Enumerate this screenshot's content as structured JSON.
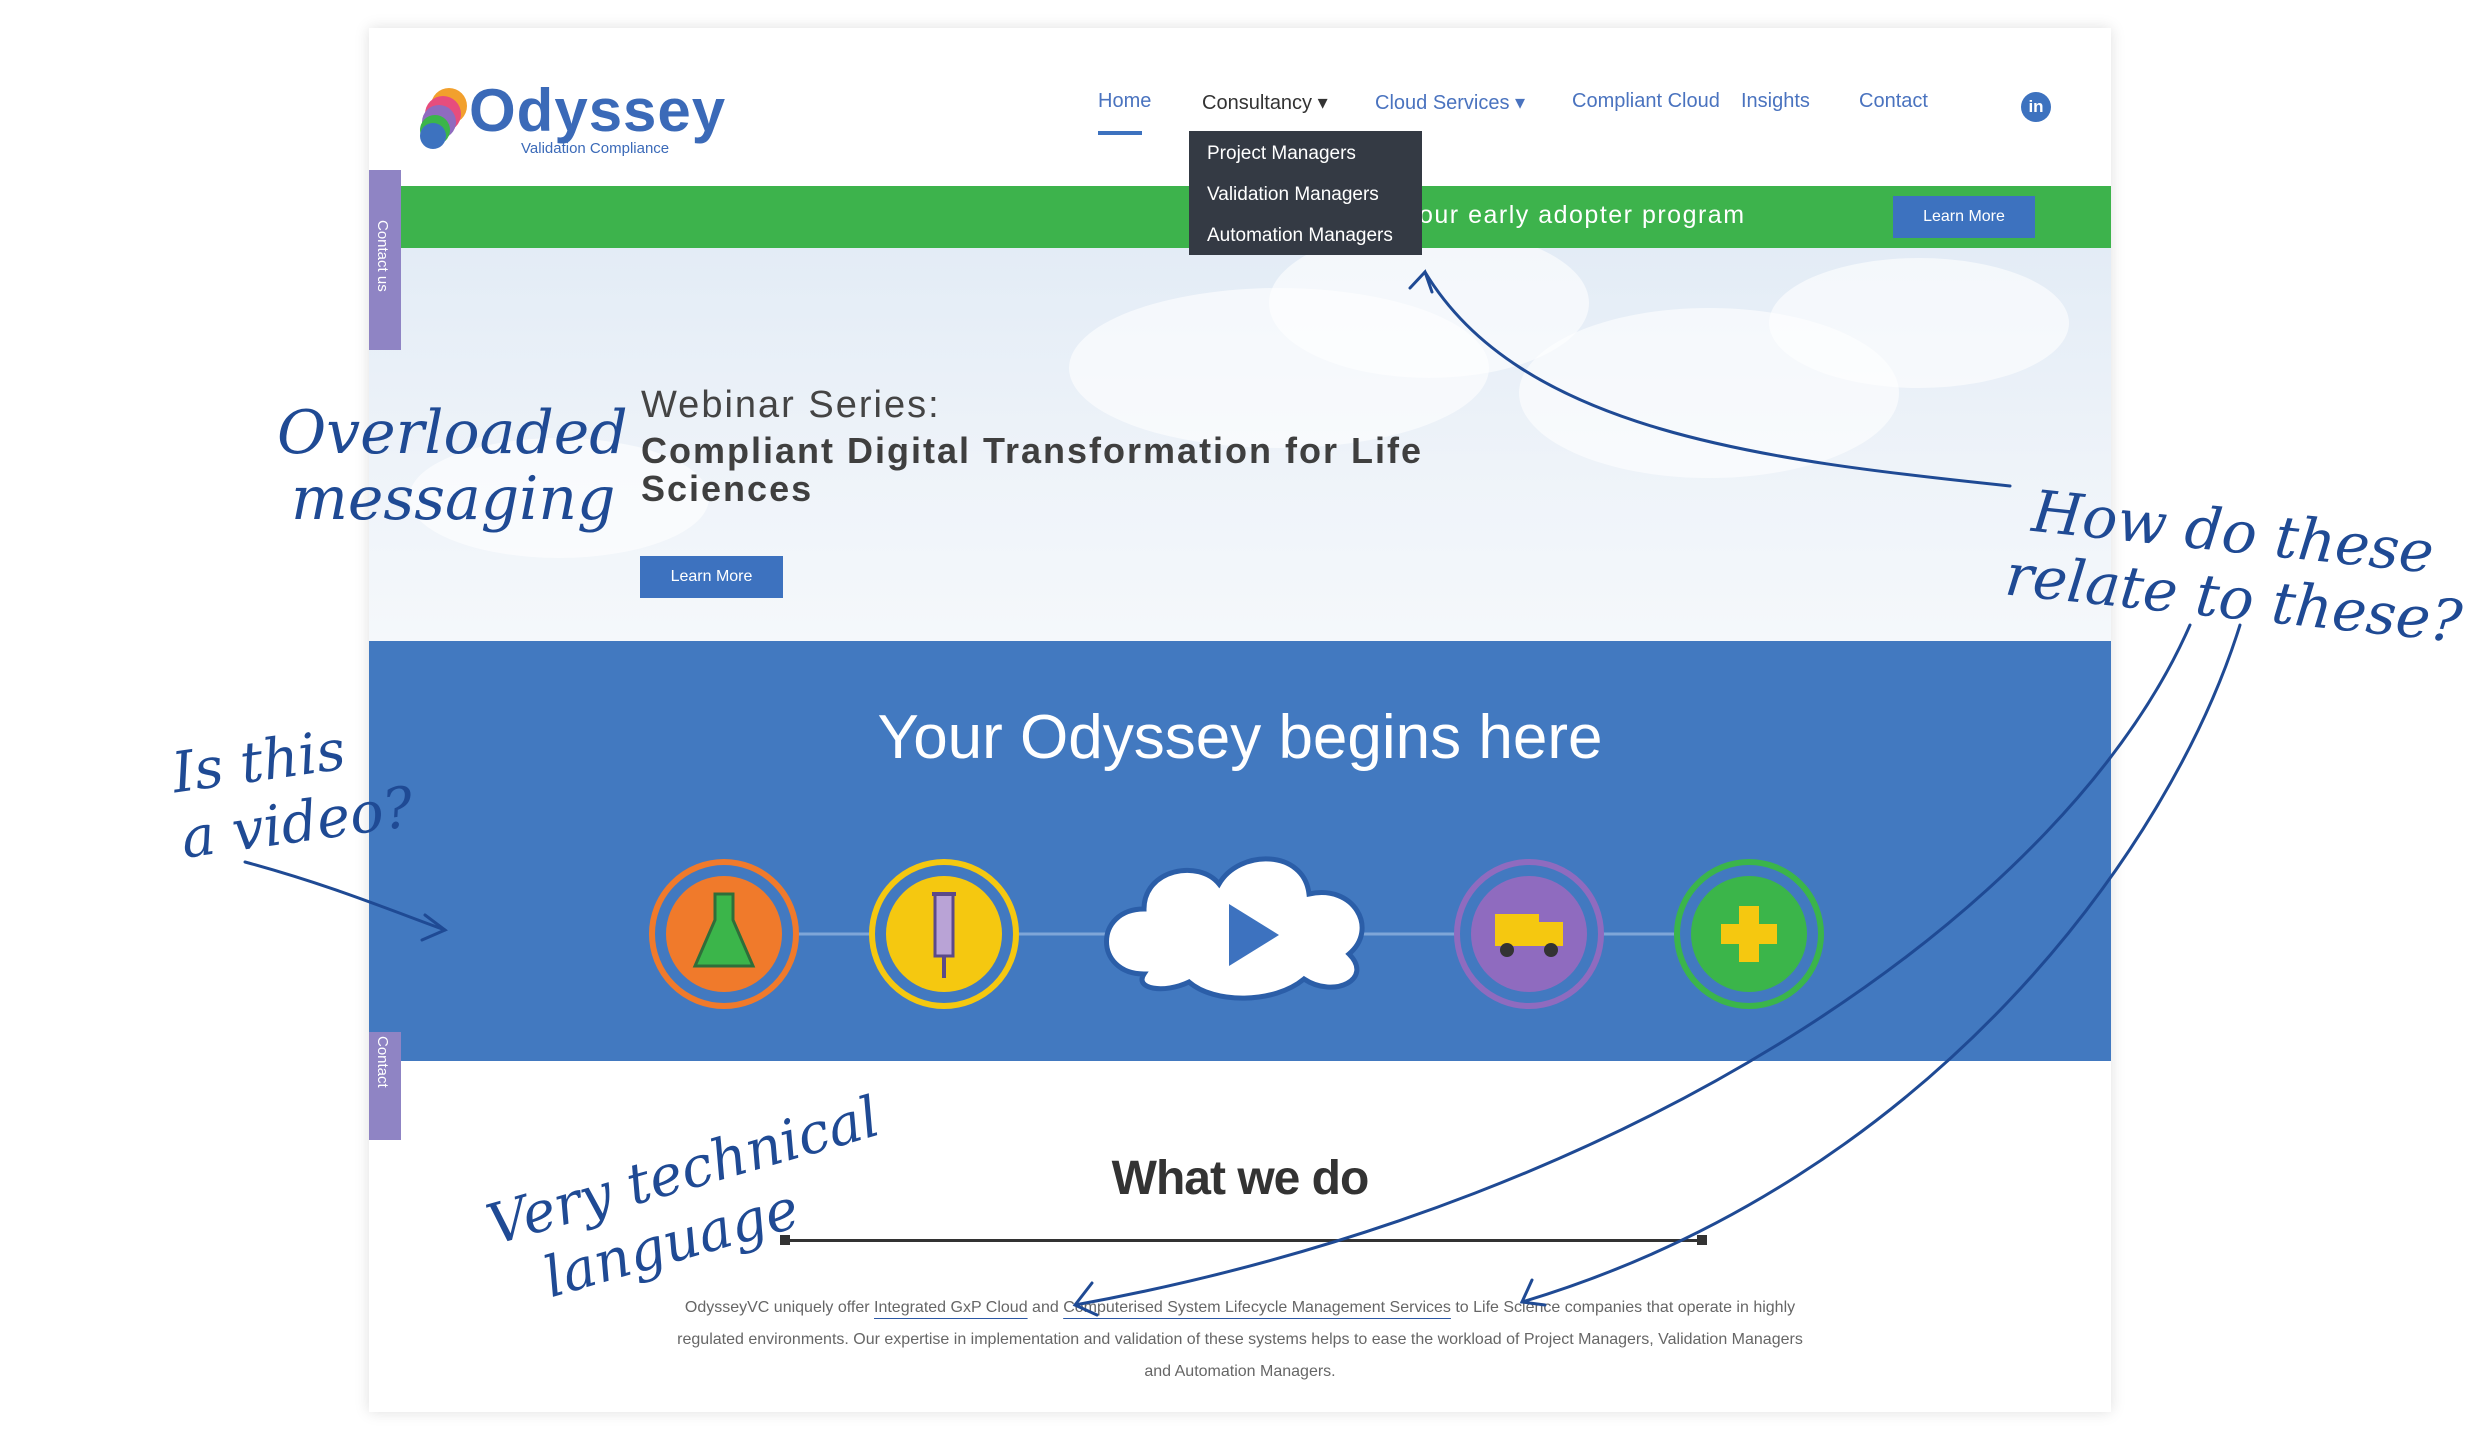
{
  "header": {
    "logo_name": "Odyssey",
    "logo_tagline": "Validation Compliance",
    "nav": [
      "Home",
      "Consultancy ▾",
      "Cloud Services ▾",
      "Compliant Cloud",
      "Insights",
      "Contact"
    ],
    "linkedin_label": "in",
    "dropdown": [
      "Project Managers",
      "Validation Managers",
      "Automation Managers"
    ]
  },
  "banner": {
    "text": "our early adopter program",
    "button": "Learn More"
  },
  "hero": {
    "title": "Webinar Series:",
    "subtitle": "Compliant Digital Transformation for Life Sciences",
    "button": "Learn More"
  },
  "side_tabs": [
    "Contact us",
    "Contact"
  ],
  "video": {
    "title": "Your Odyssey begins here",
    "icons": [
      "flask-icon",
      "syringe-icon",
      "play-cloud-icon",
      "truck-icon",
      "plus-icon"
    ]
  },
  "what_we_do": {
    "title": "What we do",
    "p1": "OdysseyVC uniquely offer ",
    "link1": "Integrated GxP Cloud",
    "p2": " and ",
    "link2": "Computerised System Lifecycle Management Services",
    "p3": " to Life Science companies that operate in highly regulated environments. Our expertise in implementation and validation of these systems helps to ease the workload of Project Managers, Validation Managers and Automation Managers."
  },
  "annotations": {
    "overloaded": [
      "Overloaded",
      "messaging"
    ],
    "video_q": [
      "Is this",
      "a video?"
    ],
    "technical": [
      "Very technical",
      "language"
    ],
    "relate": [
      "How do these",
      "relate to these?"
    ]
  },
  "colors": {
    "brand_blue": "#3d72bf",
    "video_band": "#4279c0",
    "green_banner": "#3db34c",
    "dropdown_bg": "#343a44",
    "annotation_ink": "#1f4a94"
  }
}
